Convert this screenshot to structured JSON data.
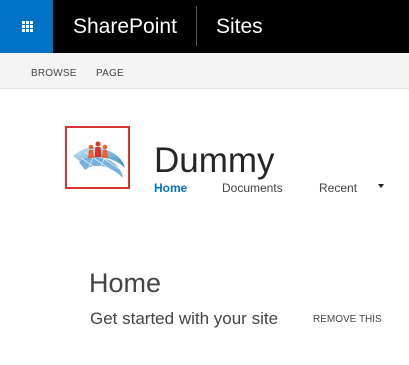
{
  "suite_bar": {
    "app_name": "SharePoint",
    "sites_label": "Sites",
    "brand_color": "#0072c6",
    "waffle_icon": "app-launcher-icon"
  },
  "ribbon": {
    "tabs": [
      {
        "label": "BROWSE"
      },
      {
        "label": "PAGE"
      }
    ]
  },
  "site": {
    "title": "Dummy",
    "logo_icon": "site-logo-icon"
  },
  "top_nav": {
    "items": [
      {
        "label": "Home",
        "active": true
      },
      {
        "label": "Documents",
        "active": false
      },
      {
        "label": "Recent",
        "active": false
      }
    ],
    "dropdown_icon": "caret-down-icon"
  },
  "main": {
    "heading": "Home",
    "get_started": "Get started with your site",
    "remove_label": "REMOVE THIS"
  }
}
